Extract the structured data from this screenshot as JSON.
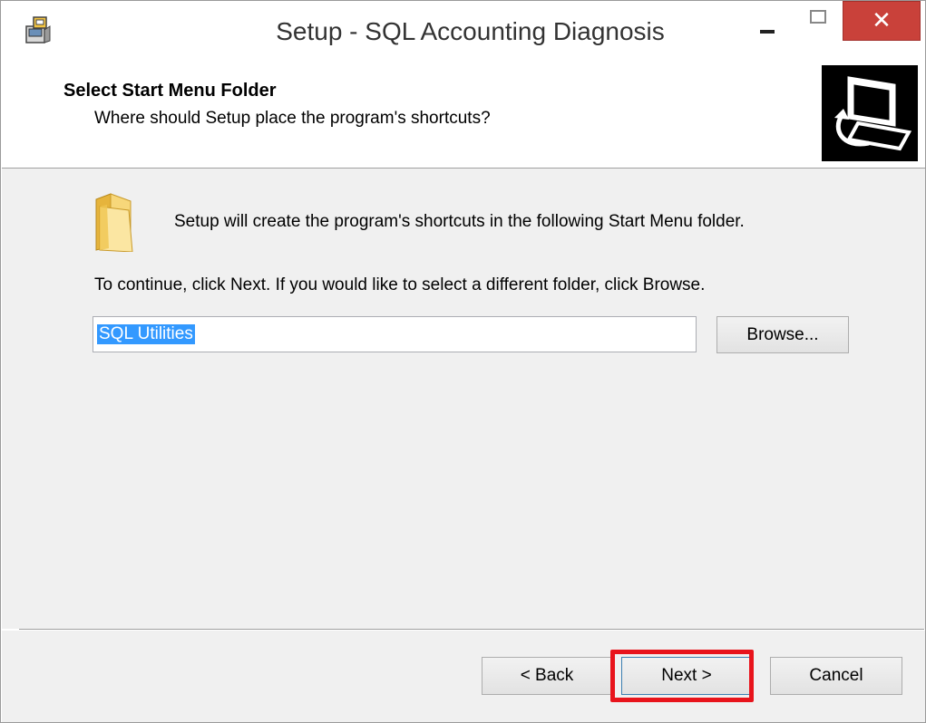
{
  "window": {
    "title": "Setup - SQL Accounting Diagnosis",
    "controls": {
      "minimize": "minimize",
      "maximize": "maximize",
      "close_glyph": "✕"
    }
  },
  "header": {
    "title": "Select Start Menu Folder",
    "subtitle": "Where should Setup place the program's shortcuts?"
  },
  "content": {
    "setup_message": "Setup will create the program's shortcuts in the following Start Menu folder.",
    "continue_message": "To continue, click Next. If you would like to select a different folder, click Browse.",
    "folder_value": "SQL Utilities",
    "browse_label": "Browse..."
  },
  "footer": {
    "back_label": "< Back",
    "next_label": "Next >",
    "cancel_label": "Cancel"
  },
  "icons": {
    "app": "installer-icon",
    "header": "computer-install-icon",
    "folder": "folder-icon"
  },
  "colors": {
    "close_button": "#c9413a",
    "highlight_border": "#e8141c",
    "selection": "#3399ff",
    "panel": "#f0f0f0"
  }
}
